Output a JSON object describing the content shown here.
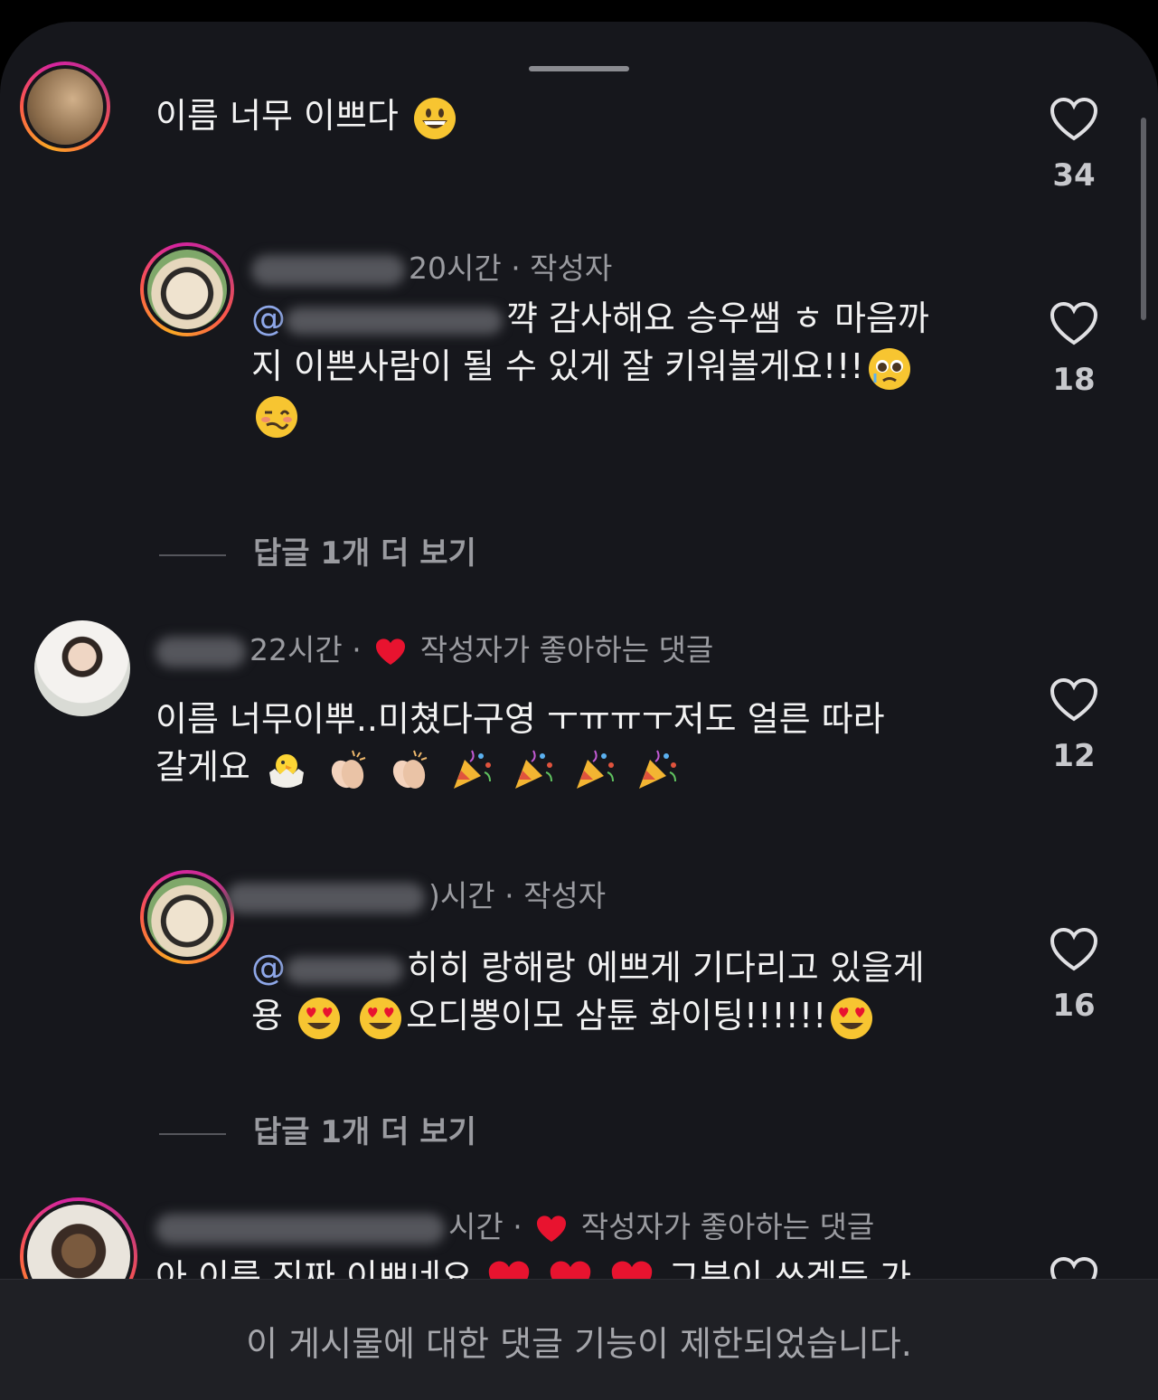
{
  "comments": [
    {
      "text": "이름 너무 이쁘다",
      "likes": "34"
    },
    {
      "meta": "20시간 · 작성자",
      "mention": "@",
      "text_line1": "꺅 감사해요 승우쌤 ㅎ 마음까",
      "text_line2": "지 이쁜사람이 될 수 있게 잘 키워볼게요!!!",
      "likes": "18"
    },
    {
      "meta_time": "22시간 ·",
      "meta_liked": "작성자가 좋아하는 댓글",
      "text_line1": "이름 너무이뿌..미쳤다구영 ㅜㅠㅠㅜ저도 얼른 따라",
      "text_line2": "갈게요",
      "likes": "12"
    },
    {
      "meta": "시간 · 작성자",
      "meta_prefix": ")",
      "mention": "@",
      "text_line1": "히히 랑해랑 에쁘게 기다리고 있을게",
      "text_line2_a": "용",
      "text_line2_b": "오디뽕이모 삼튠 화이팅!!!!!!",
      "likes": "16"
    },
    {
      "meta_time": "시간 ·",
      "meta_liked": "작성자가 좋아하는 댓글",
      "text_partial": "아 이름 진짜 이쁘네요",
      "text_partial2": "그분이 쓰겠든 가"
    }
  ],
  "more_replies": [
    "답글 1개 더 보기",
    "답글 1개 더 보기"
  ],
  "footer": {
    "notice": "이 게시물에 대한 댓글 기능이 제한되었습니다."
  },
  "icons": [
    "heart-outline-icon",
    "heart-filled-icon",
    "grinning-emoji",
    "pleading-emoji",
    "woozy-emoji",
    "hatching-chick-emoji",
    "clapping-emoji",
    "party-popper-emoji",
    "heart-eyes-emoji",
    "red-heart-emoji"
  ],
  "colors": {
    "background": "#16171c",
    "mention": "#8ea7e8",
    "heart": "#e8132f"
  }
}
